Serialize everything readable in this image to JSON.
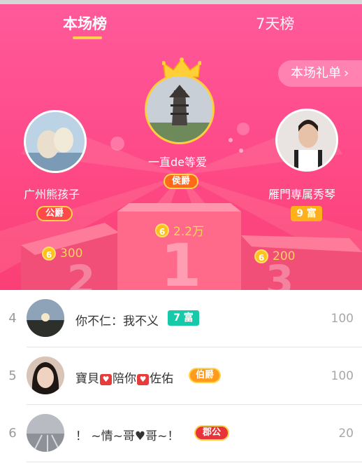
{
  "tabs": {
    "current": "本场榜",
    "week": "7天榜"
  },
  "gift_list_button": {
    "label": "本场礼单",
    "chevron": "›"
  },
  "podium": [
    {
      "rank": 1,
      "name": "一直de等爱",
      "title": "侯爵",
      "score": "2.2万",
      "coin": "6"
    },
    {
      "rank": 2,
      "name": "广州熊孩子",
      "title": "公爵",
      "score": "300",
      "coin": "6"
    },
    {
      "rank": 3,
      "name": "雁門専属秀琴",
      "title": "9 富",
      "score": "200",
      "coin": "6"
    }
  ],
  "list": [
    {
      "rank": "4",
      "name": "你不仁：我不义",
      "badge": "7 富",
      "score": "100"
    },
    {
      "rank": "5",
      "name_parts": [
        "寶貝",
        "陪你",
        "佐佑"
      ],
      "badge": "伯爵",
      "score": "100"
    },
    {
      "rank": "6",
      "name": "！ ~情~哥♥哥~！",
      "badge": "郡公",
      "score": "20"
    }
  ],
  "colors": {
    "bg_top": "#ff5a9a",
    "bg_bottom": "#fb3f76",
    "gold": "#ffd45a",
    "teal_badge": "#16c9a8"
  },
  "icons": [
    "crown-icon",
    "coin-icon",
    "chevron-right-icon",
    "heart-icon"
  ]
}
